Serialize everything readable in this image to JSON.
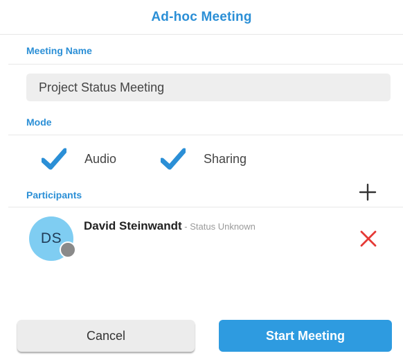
{
  "dialog": {
    "title": "Ad-hoc Meeting"
  },
  "meeting_name": {
    "label": "Meeting Name",
    "value": "Project Status Meeting",
    "placeholder": ""
  },
  "mode": {
    "label": "Mode",
    "options": [
      {
        "label": "Audio",
        "checked": true
      },
      {
        "label": "Sharing",
        "checked": true
      }
    ]
  },
  "participants": {
    "label": "Participants",
    "add_icon": "plus-icon",
    "items": [
      {
        "initials": "DS",
        "name": "David Steinwandt",
        "status": " - Status Unknown",
        "remove_icon": "close-icon"
      }
    ]
  },
  "actions": {
    "cancel_label": "Cancel",
    "start_label": "Start Meeting"
  },
  "colors": {
    "accent": "#2b8fd6",
    "primary_button": "#2e9be0",
    "avatar": "#7fcdf2",
    "presence_unknown": "#8a8a8a",
    "remove": "#e53935",
    "input_bg": "#eeeeee"
  }
}
